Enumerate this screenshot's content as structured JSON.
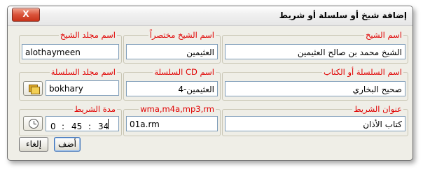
{
  "window": {
    "title": "إضافة شيخ أو سلسلة أو شريط",
    "close_label": "X"
  },
  "sheikh": {
    "name_legend": "اسم الشيخ",
    "name_value": "الشيخ محمد بن صالح العثيمين",
    "short_legend": "اسم الشيخ مختصراً",
    "short_value": "العثيمين",
    "folder_legend": "اسم مجلد الشيخ",
    "folder_value": "alothaymeen"
  },
  "series": {
    "name_legend": "اسم السلسلة أو الكتاب",
    "name_value": "صحيح البخاري",
    "cd_legend": "اسم CD السلسلة",
    "cd_value": "العثيمين-4",
    "folder_legend": "اسم مجلد السلسلة",
    "folder_value": "bokhary"
  },
  "tape": {
    "title_legend": "عنوان الشريط",
    "title_value": "كتاب الأذان",
    "file_legend": "wma,m4a,mp3,rm",
    "file_value": "01a.rm",
    "duration_legend": "مدة الشريط",
    "duration": {
      "hours": "0",
      "minutes": "45",
      "seconds": "34"
    }
  },
  "buttons": {
    "add": "أضف",
    "cancel": "إلغاء"
  },
  "icons": {
    "browse": "folder-icon",
    "time": "clock-icon",
    "close": "close-icon"
  },
  "colors": {
    "legend_text": "#e00000",
    "dialog_bg": "#efeee7",
    "close_button": "#d9533a"
  }
}
